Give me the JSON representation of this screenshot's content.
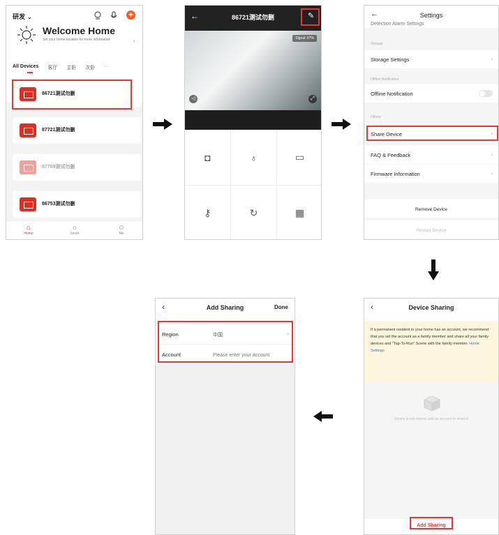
{
  "screen1": {
    "home_name": "研发 ⌄",
    "welcome": "Welcome Home",
    "sub": "Set your home location for more information",
    "tabs": [
      "All Devices",
      "客厅",
      "主卧",
      "次卧",
      "···"
    ],
    "devices": [
      "86721测试勿删",
      "87721测试勿删",
      "87709测试勿删",
      "86753测试勿删"
    ],
    "bottom_tabs": [
      "Home",
      "Smart",
      "Me"
    ]
  },
  "screen2": {
    "title": "86721测试勿删",
    "signal": "Signal: 87%"
  },
  "screen3": {
    "title": "Settings",
    "partial_row": "Detection Alarm Settings",
    "section_storage": "Storage",
    "storage_settings": "Storage Settings",
    "section_offline": "Offline Notification",
    "offline_notification": "Offline Notification",
    "section_others": "Others",
    "share_device": "Share Device",
    "faq": "FAQ & Feedback",
    "firmware": "Firmware Information",
    "remove_device": "Remove Device",
    "restart_device": "Restart Device"
  },
  "screen4": {
    "title": "Device Sharing",
    "notice": "If a permanent resident in your home has an account, we recommend that you set the account as a family member and share all your family devices and \"Tap-To-Run\" Scene with the family member.",
    "notice_link": "Home Settings",
    "empty_text": "Device is not shared, add an account to share it",
    "add_sharing": "Add Sharing"
  },
  "screen5": {
    "title": "Add Sharing",
    "done": "Done",
    "region_label": "Region",
    "region_value": "中国",
    "account_label": "Account",
    "account_placeholder": "Please enter your account"
  },
  "colors": {
    "accent_red": "#e53935",
    "brand_red": "#d93025",
    "link_blue": "#2b7bd9",
    "notice_bg": "#fdf6dc"
  }
}
